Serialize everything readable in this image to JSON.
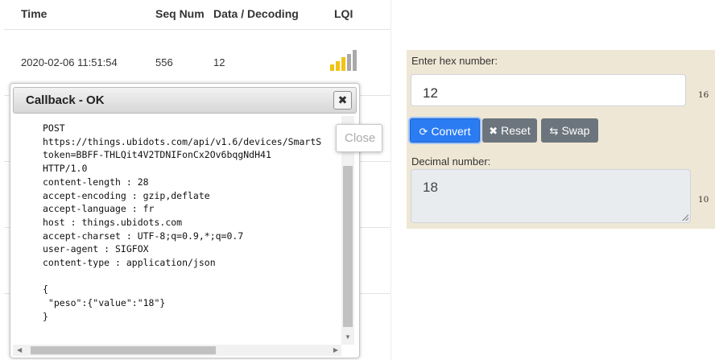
{
  "table": {
    "headers": {
      "time": "Time",
      "seq": "Seq Num",
      "data": "Data / Decoding",
      "lqi": "LQI"
    },
    "rows": [
      {
        "time": "2020-02-06 11:51:54",
        "seq": "556",
        "data": "12",
        "lqi_bars_active": 3,
        "lqi_bars_total": 5
      }
    ],
    "lqi_colors": {
      "active": "#f2c313",
      "inactive": "#a9a9a9"
    }
  },
  "dialog": {
    "title": "Callback - OK",
    "close_icon": "close-x-icon",
    "body_lines": [
      "POST",
      "https://things.ubidots.com/api/v1.6/devices/SmartS",
      "token=BBFF-THLQit4V2TDNIFonCx2Ov6bqgNdH41",
      "HTTP/1.0",
      "content-length : 28",
      "accept-encoding : gzip,deflate",
      "accept-language : fr",
      "host : things.ubidots.com",
      "accept-charset : UTF-8;q=0.9,*;q=0.7",
      "user-agent : SIGFOX",
      "content-type : application/json",
      "",
      "{",
      " \"peso\":{\"value\":\"18\"}",
      "}"
    ],
    "close_tooltip": "Close"
  },
  "converter": {
    "hex_label": "Enter hex number:",
    "hex_value": "12",
    "hex_base": "16",
    "buttons": {
      "convert": {
        "label": "Convert",
        "icon": "refresh-icon",
        "color": "#2b7cf2"
      },
      "reset": {
        "label": "Reset",
        "icon": "times-icon",
        "color": "#6c757d"
      },
      "swap": {
        "label": "Swap",
        "icon": "swap-icon",
        "color": "#6c757d"
      }
    },
    "dec_label": "Decimal number:",
    "dec_value": "18",
    "dec_base": "10",
    "background": "#efe7d5"
  }
}
